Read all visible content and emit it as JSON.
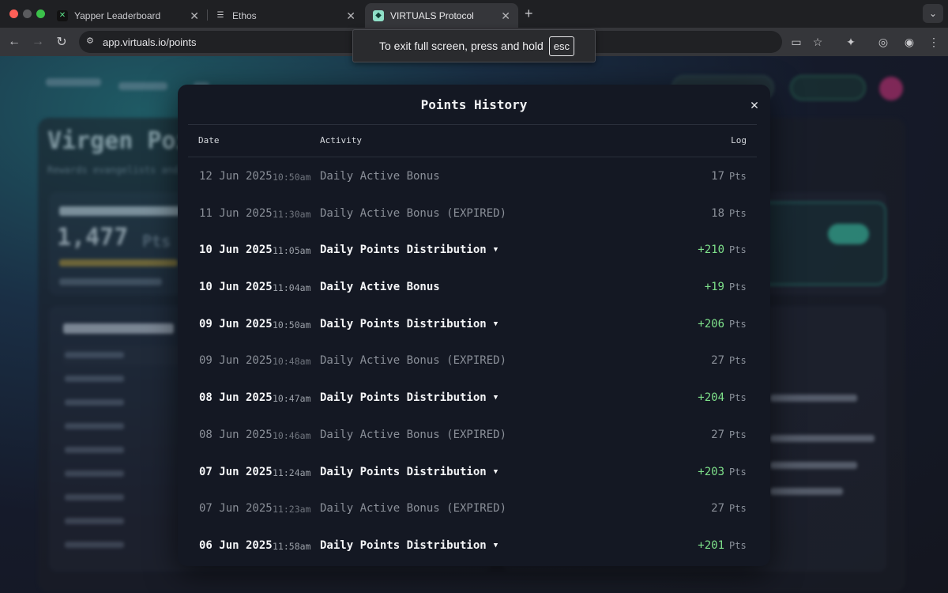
{
  "browser": {
    "tabs": [
      {
        "title": "Yapper Leaderboard",
        "icon": "x-logo-icon"
      },
      {
        "title": "Ethos",
        "icon": "ethos-logo-icon"
      },
      {
        "title": "VIRTUALS Protocol",
        "icon": "virtuals-logo-icon"
      }
    ],
    "url": "app.virtuals.io/points",
    "fullscreen_toast": {
      "text": "To exit full screen, press and hold",
      "key": "esc"
    }
  },
  "background_page": {
    "title": "Virgen Poi",
    "big_value": "1,477",
    "big_unit": "Pts"
  },
  "modal": {
    "title": "Points History",
    "columns": {
      "date": "Date",
      "activity": "Activity",
      "log": "Log"
    },
    "rows": [
      {
        "date": "12 Jun 2025",
        "time": "10:50am",
        "activity": "Daily Active Bonus",
        "amount": "17",
        "unit": "Pts",
        "style": "dim",
        "expandable": false
      },
      {
        "date": "11 Jun 2025",
        "time": "11:30am",
        "activity": "Daily Active Bonus (EXPIRED)",
        "amount": "18",
        "unit": "Pts",
        "style": "dim",
        "expandable": false
      },
      {
        "date": "10 Jun 2025",
        "time": "11:05am",
        "activity": "Daily Points Distribution",
        "amount": "+210",
        "unit": "Pts",
        "style": "bright",
        "expandable": true
      },
      {
        "date": "10 Jun 2025",
        "time": "11:04am",
        "activity": "Daily Active Bonus",
        "amount": "+19",
        "unit": "Pts",
        "style": "bright",
        "expandable": false
      },
      {
        "date": "09 Jun 2025",
        "time": "10:50am",
        "activity": "Daily Points Distribution",
        "amount": "+206",
        "unit": "Pts",
        "style": "bright",
        "expandable": true
      },
      {
        "date": "09 Jun 2025",
        "time": "10:48am",
        "activity": "Daily Active Bonus (EXPIRED)",
        "amount": "27",
        "unit": "Pts",
        "style": "dim",
        "expandable": false
      },
      {
        "date": "08 Jun 2025",
        "time": "10:47am",
        "activity": "Daily Points Distribution",
        "amount": "+204",
        "unit": "Pts",
        "style": "bright",
        "expandable": true
      },
      {
        "date": "08 Jun 2025",
        "time": "10:46am",
        "activity": "Daily Active Bonus (EXPIRED)",
        "amount": "27",
        "unit": "Pts",
        "style": "dim",
        "expandable": false
      },
      {
        "date": "07 Jun 2025",
        "time": "11:24am",
        "activity": "Daily Points Distribution",
        "amount": "+203",
        "unit": "Pts",
        "style": "bright",
        "expandable": true
      },
      {
        "date": "07 Jun 2025",
        "time": "11:23am",
        "activity": "Daily Active Bonus (EXPIRED)",
        "amount": "27",
        "unit": "Pts",
        "style": "dim",
        "expandable": false
      },
      {
        "date": "06 Jun 2025",
        "time": "11:58am",
        "activity": "Daily Points Distribution",
        "amount": "+201",
        "unit": "Pts",
        "style": "bright",
        "expandable": true
      }
    ]
  },
  "colors": {
    "positive": "#7ee08a",
    "modal_bg": "#141823",
    "accent_green": "#3fd7b2"
  }
}
